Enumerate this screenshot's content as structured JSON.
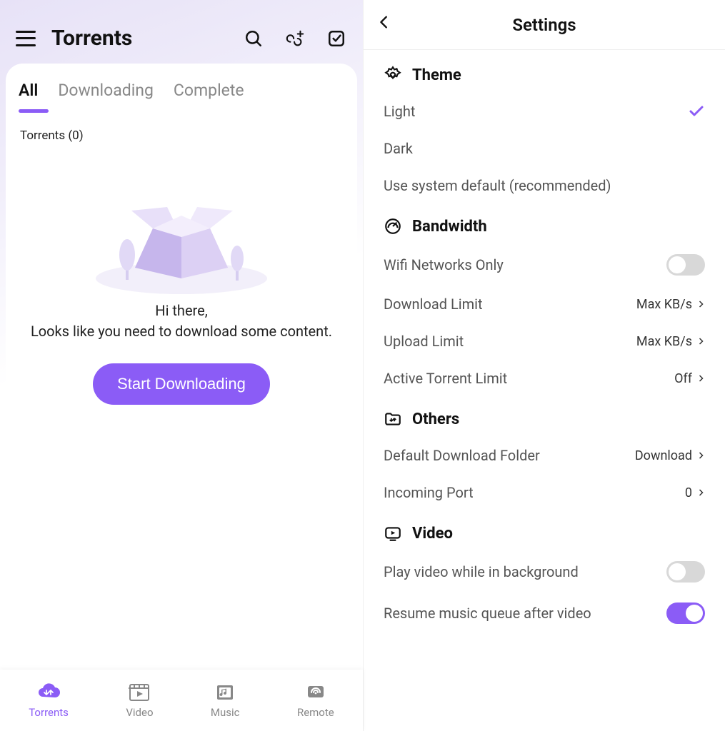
{
  "left": {
    "title": "Torrents",
    "tabs": {
      "all": "All",
      "downloading": "Downloading",
      "complete": "Complete"
    },
    "count_label": "Torrents (0)",
    "empty_line1": "Hi there,",
    "empty_line2": "Looks like you need to download some content.",
    "start_button": "Start Downloading",
    "nav": {
      "torrents": "Torrents",
      "video": "Video",
      "music": "Music",
      "remote": "Remote"
    }
  },
  "right": {
    "title": "Settings",
    "sections": {
      "theme": {
        "header": "Theme",
        "light": "Light",
        "dark": "Dark",
        "system": "Use system default (recommended)"
      },
      "bandwidth": {
        "header": "Bandwidth",
        "wifi": "Wifi Networks Only",
        "download_limit": "Download Limit",
        "download_limit_val": "Max KB/s",
        "upload_limit": "Upload Limit",
        "upload_limit_val": "Max KB/s",
        "active_limit": "Active Torrent Limit",
        "active_limit_val": "Off"
      },
      "others": {
        "header": "Others",
        "default_folder": "Default Download Folder",
        "default_folder_val": "Download",
        "incoming_port": "Incoming Port",
        "incoming_port_val": "0"
      },
      "video": {
        "header": "Video",
        "bg_play": "Play video while in background",
        "resume_music": "Resume music queue after video"
      }
    }
  }
}
